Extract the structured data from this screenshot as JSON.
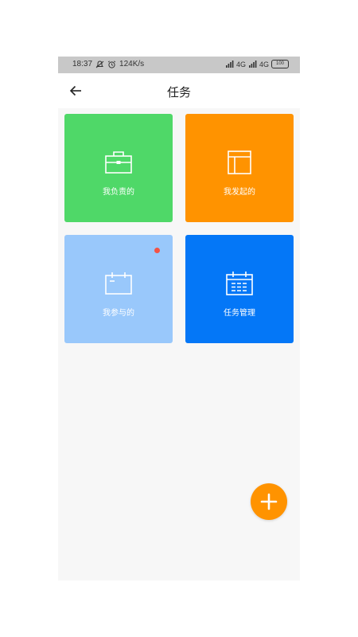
{
  "status_bar": {
    "time": "18:37",
    "speed": "124K/s",
    "network1": "4G",
    "network2": "4G",
    "battery": "100"
  },
  "header": {
    "title": "任务"
  },
  "tiles": [
    {
      "label": "我负责的",
      "color": "#4fd868",
      "icon": "briefcase-icon"
    },
    {
      "label": "我发起的",
      "color": "#ff9300",
      "icon": "layout-icon"
    },
    {
      "label": "我参与的",
      "color": "#99c8fb",
      "icon": "calendar-blank-icon"
    },
    {
      "label": "任务管理",
      "color": "#0477f7",
      "icon": "calendar-list-icon"
    }
  ],
  "colors": {
    "badge": "#f25345",
    "fab": "#ff9300"
  },
  "fab": {
    "icon": "plus-icon"
  }
}
